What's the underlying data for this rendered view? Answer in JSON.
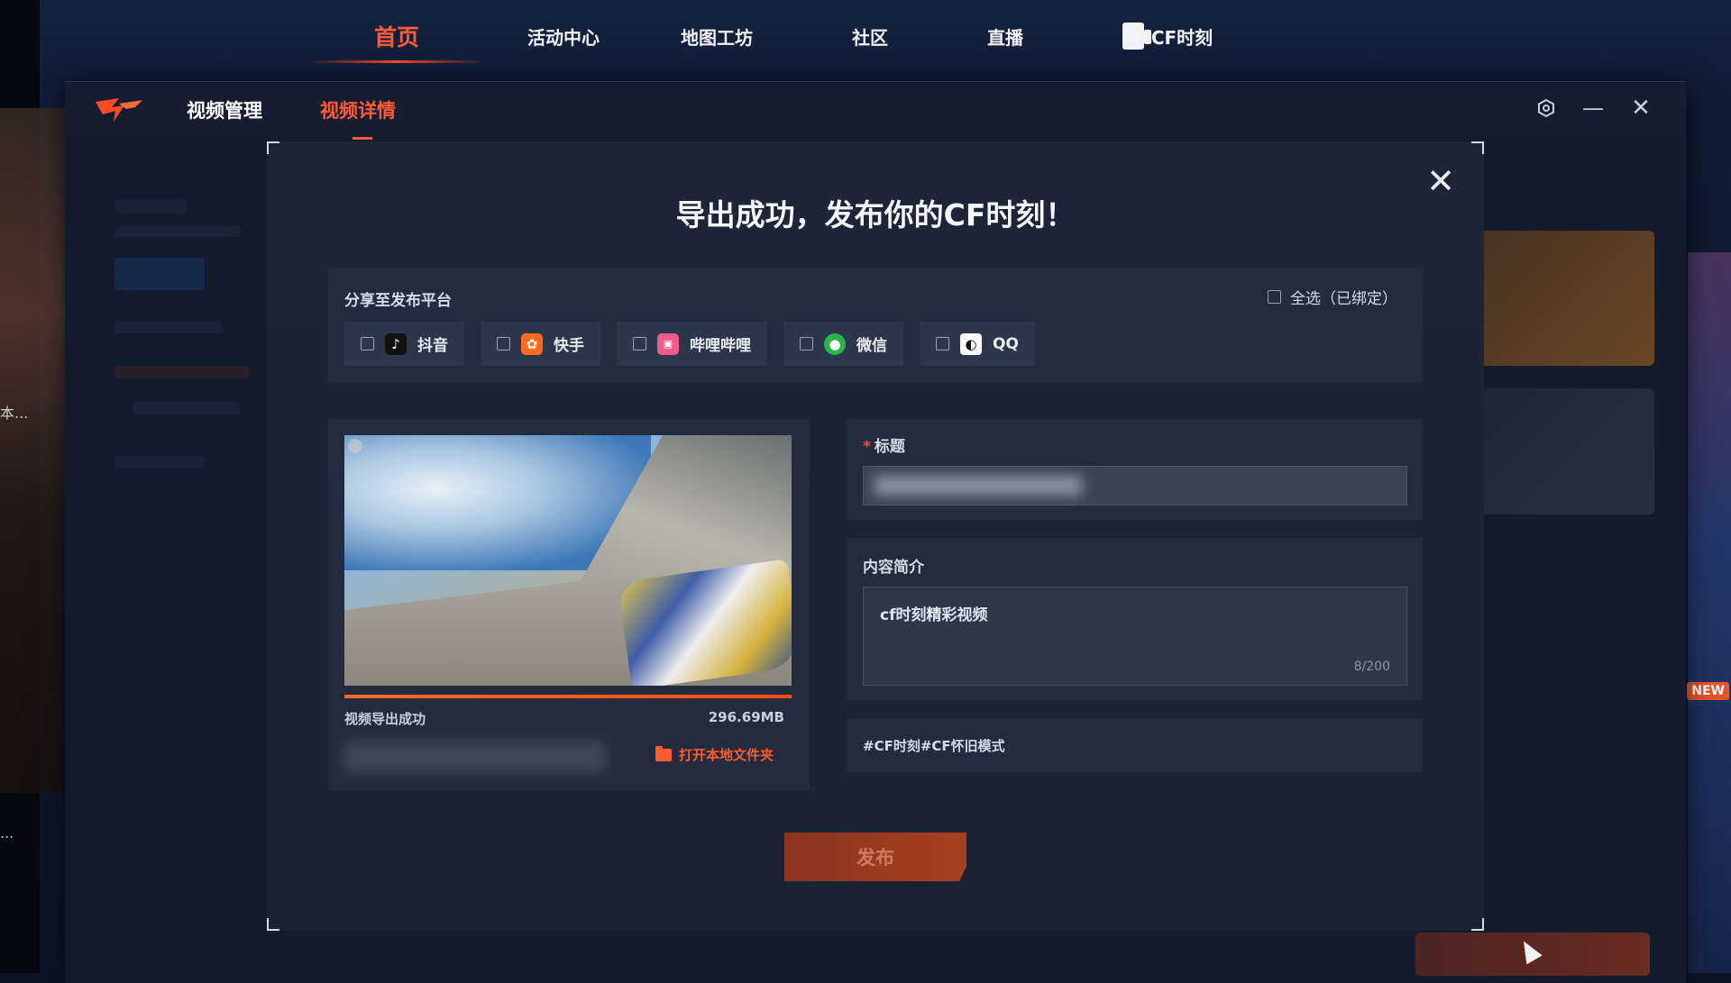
{
  "top_nav": {
    "items": [
      "首页",
      "活动中心",
      "地图工坊",
      "社区",
      "直播"
    ],
    "cf_moment": "CF时刻",
    "active": "首页"
  },
  "window": {
    "tabs": [
      "视频管理",
      "视频详情"
    ],
    "active_tab": "视频详情",
    "controls": {
      "settings": "settings-icon",
      "minimize": "minimize-icon",
      "close": "close-icon"
    }
  },
  "background": {
    "side_label": "本...",
    "side_dots": "...",
    "new_badge": "NEW"
  },
  "dialog": {
    "title": "导出成功，发布你的CF时刻！",
    "close_icon": "close-icon",
    "share": {
      "label": "分享至发布平台",
      "select_all": "全选（已绑定）",
      "platforms": [
        {
          "name": "抖音",
          "icon": "douyin-icon",
          "color": "#111111",
          "glyph": "♪"
        },
        {
          "name": "快手",
          "icon": "kuaishou-icon",
          "color": "#ff6a1f",
          "glyph": "✿"
        },
        {
          "name": "哔哩哔哩",
          "icon": "bilibili-icon",
          "color": "#f05a8c",
          "glyph": "▣"
        },
        {
          "name": "微信",
          "icon": "wechat-icon",
          "color": "#2bb248",
          "glyph": "●"
        },
        {
          "name": "QQ",
          "icon": "qq-icon",
          "color": "#ffffff",
          "glyph": "◐"
        }
      ]
    },
    "video": {
      "status": "视频导出成功",
      "size": "296.69MB",
      "progress": 1.0,
      "open_folder": "打开本地文件夹"
    },
    "form": {
      "title_label": "标题",
      "required_mark": "*",
      "desc_label": "内容简介",
      "desc_value": "cf时刻精彩视频",
      "char_count": "8/200",
      "tags": "#CF时刻#CF怀旧模式"
    },
    "publish": "发布"
  },
  "colors": {
    "accent": "#ff5a36",
    "panel": "#222c3e",
    "dialog": "#1c2638"
  }
}
